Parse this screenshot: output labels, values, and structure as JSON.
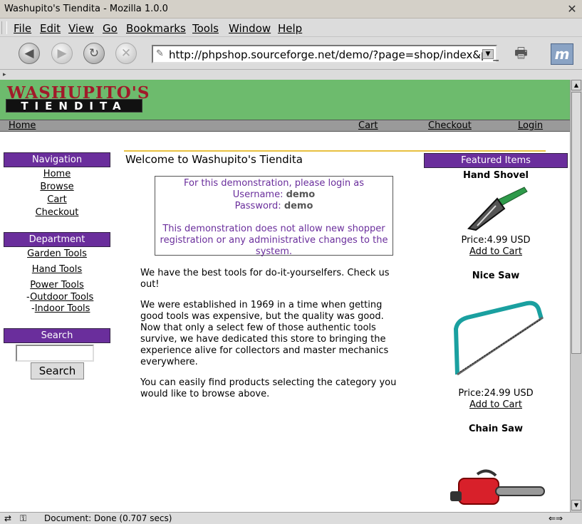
{
  "window": {
    "title": "Washupito's Tiendita - Mozilla 1.0.0"
  },
  "menu": [
    "File",
    "Edit",
    "View",
    "Go",
    "Bookmarks",
    "Tools",
    "Window",
    "Help"
  ],
  "toolbar": {
    "url": "http://phpshop.sourceforge.net/demo/?page=shop/index&ps_"
  },
  "status": {
    "text": "Document: Done (0.707 secs)"
  },
  "site": {
    "logo_top": "WASHUPITO'S",
    "logo_bottom": "TIENDITA",
    "topnav": {
      "home": "Home",
      "cart": "Cart",
      "checkout": "Checkout",
      "login": "Login"
    }
  },
  "sidebar": {
    "nav_title": "Navigation",
    "nav_items": [
      "Home",
      "Browse",
      "Cart",
      "Checkout"
    ],
    "dept_title": "Department",
    "dept_items": [
      "Garden Tools",
      "Hand Tools",
      "Power Tools"
    ],
    "dept_sub": [
      "Outdoor Tools",
      "Indoor Tools"
    ],
    "search_title": "Search",
    "search_button": "Search"
  },
  "main": {
    "welcome": "Welcome to Washupito's Tiendita",
    "demo_line1": "For this demonstration, please login as",
    "demo_user_label": "Username:",
    "demo_user": "demo",
    "demo_pass_label": "Password:",
    "demo_pass": "demo",
    "demo_note": "This demonstration does not allow new shopper registration or any administrative changes to the system.",
    "para1": "We have the best tools for do-it-yourselfers. Check us out!",
    "para2": "We were established in 1969 in a time when getting good tools was expensive, but the quality was good. Now that only a select few of those authentic tools survive, we have dedicated this store to bringing the experience alive for collectors and master mechanics everywhere.",
    "para3": "You can easily find products selecting the category you would like to browse above."
  },
  "featured": {
    "title": "Featured Items",
    "items": [
      {
        "name": "Hand Shovel",
        "price": "Price:4.99 USD",
        "add": "Add to Cart"
      },
      {
        "name": "Nice Saw",
        "price": "Price:24.99 USD",
        "add": "Add to Cart"
      },
      {
        "name": "Chain Saw"
      }
    ]
  }
}
